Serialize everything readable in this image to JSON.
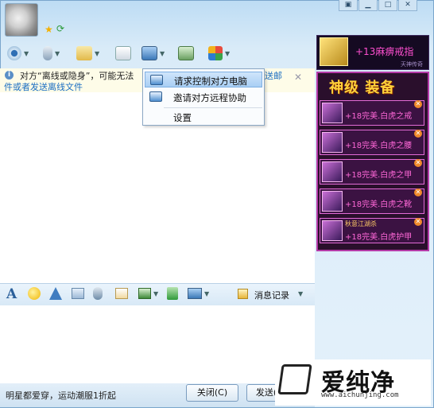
{
  "info_bar": {
    "line1": "对方“离线或隐身”，可能无法",
    "line1_tail": "送邮",
    "line2_prefix": "件或者",
    "line2_link": "发送离线文件"
  },
  "menu": {
    "items": [
      {
        "label": "请求控制对方电脑",
        "icon": "remote-control-icon"
      },
      {
        "label": "邀请对方远程协助",
        "icon": "remote-assist-icon"
      },
      {
        "label": "设置"
      }
    ]
  },
  "bottom_toolbar": {
    "history_label": "消息记录"
  },
  "status": {
    "text": "明星都爱穿，运动潮服1折起"
  },
  "buttons": {
    "close": "关闭(C)",
    "send": "发送("
  },
  "ad": {
    "top_text": "+13麻痹戒指",
    "top_sub": "天神传奇",
    "title": "神级 装备",
    "items": [
      {
        "text": "+18完美.白虎之戒"
      },
      {
        "text": "+18完美.白虎之腰"
      },
      {
        "text": "+18完美.白虎之甲"
      },
      {
        "text": "+18完美.白虎之靴"
      },
      {
        "sub": "秋意江湖杀",
        "text": "+18完美.白虎护甲"
      }
    ]
  },
  "watermark": {
    "brand": "爱纯净",
    "url": "www.aichunjing.com"
  },
  "colors": {
    "link": "#1b6ec2",
    "ad_accent": "#ff68d8",
    "ad_title": "#ffd23a"
  }
}
